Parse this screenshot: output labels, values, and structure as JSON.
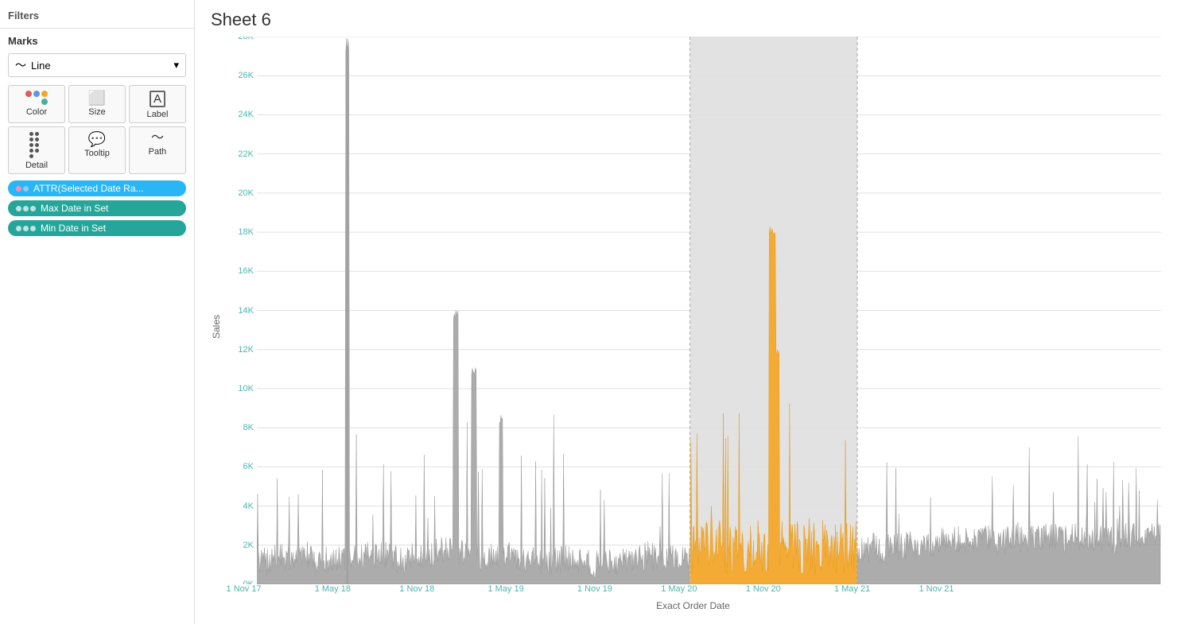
{
  "sidebar": {
    "filters_label": "Filters",
    "marks_label": "Marks",
    "marks_type": "Line",
    "marks_buttons": [
      {
        "id": "color",
        "label": "Color",
        "icon": "color"
      },
      {
        "id": "size",
        "label": "Size",
        "icon": "size"
      },
      {
        "id": "label",
        "label": "Label",
        "icon": "label"
      },
      {
        "id": "detail",
        "label": "Detail",
        "icon": "detail"
      },
      {
        "id": "tooltip",
        "label": "Tooltip",
        "icon": "tooltip"
      },
      {
        "id": "path",
        "label": "Path",
        "icon": "path"
      }
    ],
    "pills": [
      {
        "label": "ATTR(Selected Date Ra...",
        "color": "blue",
        "icon": "dots"
      },
      {
        "label": "Max Date in Set",
        "color": "green",
        "icon": "dots"
      },
      {
        "label": "Min Date in Set",
        "color": "green",
        "icon": "dots"
      }
    ]
  },
  "chart": {
    "title": "Sheet 6",
    "y_axis_label": "Sales",
    "x_axis_label": "Exact Order Date",
    "y_ticks": [
      "0K",
      "2K",
      "4K",
      "6K",
      "8K",
      "10K",
      "12K",
      "14K",
      "16K",
      "18K",
      "20K",
      "22K",
      "24K",
      "26K",
      "28K"
    ],
    "x_ticks": [
      {
        "label": "1 Nov 17",
        "pct": 0.02
      },
      {
        "label": "1 May 18",
        "pct": 0.115
      },
      {
        "label": "1 Nov 18",
        "pct": 0.205
      },
      {
        "label": "1 May 19",
        "pct": 0.3
      },
      {
        "label": "1 Nov 19",
        "pct": 0.395
      },
      {
        "label": "1 May 20",
        "pct": 0.485
      },
      {
        "label": "1 Nov 20",
        "pct": 0.575
      },
      {
        "label": "1 May 21",
        "pct": 0.67
      },
      {
        "label": "1 Nov 21",
        "pct": 0.76
      }
    ],
    "highlight_start_pct": 0.479,
    "highlight_end_pct": 0.664,
    "colors": {
      "gray_line": "#999999",
      "orange_line": "#f5a623",
      "highlight_bg": "#e0e0e0"
    }
  }
}
